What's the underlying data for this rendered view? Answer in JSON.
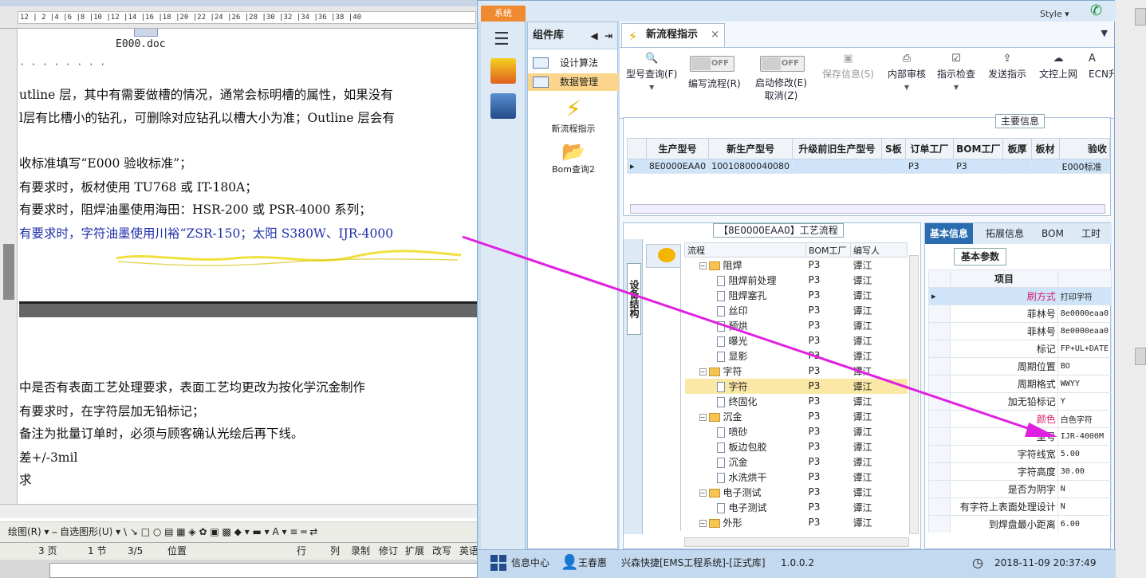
{
  "word": {
    "ruler_text": "12  | 2 |4 |6  |8  |10 |12 |14 |16 |18 |20 |22 |24 |26 |28 |30 |32 |34 |36 |38 |40",
    "file_caption": "E000.doc",
    "lines_top": [
      "· · · · · · · ·",
      "utline 层，其中有需要做槽的情况，通常会标明槽的属性，如果没有",
      "l层有比槽小的钻孔，可删除对应钻孔以槽大小为准；Outline 层会有",
      "",
      "收标准填写“E000 验收标准”；",
      "有要求时，板材使用 TU768 或 IT-180A；",
      "有要求时，阻焊油墨使用海田：HSR-200 或 PSR-4000 系列；",
      "有要求时，字符油墨使用川裕“ZSR-150；太阳 S380W、IJR-4000"
    ],
    "lines_bottom": [
      "中是否有表面工艺处理要求，表面工艺均更改为按化学沉金制作",
      "有要求时，在字符层加无铅标记；",
      "备注为批量订单时，必须与顾客确认光绘后再下线。",
      "差+/-3mil",
      "求"
    ],
    "draw_toolbar": "绘图(R) ▾  ⎯  自选图形(U) ▾  \\  ↘  □  ○  ▤  ▦  ◈  ✿  ▣  ▩   ◆ ▾  ▬ ▾  A ▾  ≡  ═  ⇄",
    "status": {
      "page": "3 页",
      "section": "1 节",
      "pos": "3/5",
      "at": "位置",
      "row": "行",
      "col": "列",
      "rec": "录制",
      "rev": "修订",
      "ext": "扩展",
      "ovr": "改写",
      "lang": "英语"
    }
  },
  "app": {
    "system_tab": "系统",
    "style_label": "Style ▾",
    "component_lib": "组件库",
    "components": [
      "设计算法",
      "数据管理"
    ],
    "launchers": [
      "新流程指示",
      "Bom查询2"
    ],
    "doc_tab": "新流程指示",
    "ribbon": {
      "b1": "型号查询(F)",
      "b2": "编写流程(R)",
      "b3": "启动修改(E)",
      "b3b": "取消(Z)",
      "b4": "保存信息(S)",
      "b5": "内部审核",
      "b6": "指示检查",
      "b7": "发送指示",
      "b8": "文控上网",
      "b9": "ECN升",
      "off": "OFF"
    },
    "main_info_label": "主要信息",
    "grid_headers": [
      "生产型号",
      "新生产型号",
      "升级前旧生产型号",
      "S板",
      "订单工厂",
      "BOM工厂",
      "板厚",
      "板材",
      "验收"
    ],
    "grid_row": [
      "8E0000EAA0",
      "10010800040080",
      "",
      "",
      "P3",
      "P3",
      "",
      "",
      "E000标准"
    ],
    "tree_title": "【8E0000EAA0】工艺流程",
    "side_tab": "设备结构",
    "tree_headers": [
      "流程",
      "BOM工厂",
      "编写人"
    ],
    "tree_rows": [
      {
        "name": "阻焊",
        "type": "folder",
        "factory": "P3",
        "author": "谭江"
      },
      {
        "name": "阻焊前处理",
        "type": "page",
        "factory": "P3",
        "author": "谭江"
      },
      {
        "name": "阻焊塞孔",
        "type": "page",
        "factory": "P3",
        "author": "谭江"
      },
      {
        "name": "丝印",
        "type": "page",
        "factory": "P3",
        "author": "谭江"
      },
      {
        "name": "预烘",
        "type": "page",
        "factory": "P3",
        "author": "谭江"
      },
      {
        "name": "曝光",
        "type": "page",
        "factory": "P3",
        "author": "谭江"
      },
      {
        "name": "显影",
        "type": "page",
        "factory": "P3",
        "author": "谭江"
      },
      {
        "name": "字符",
        "type": "folder",
        "factory": "P3",
        "author": "谭江"
      },
      {
        "name": "字符",
        "type": "page",
        "factory": "P3",
        "author": "谭江",
        "selected": true
      },
      {
        "name": "终固化",
        "type": "page",
        "factory": "P3",
        "author": "谭江"
      },
      {
        "name": "沉金",
        "type": "folder",
        "factory": "P3",
        "author": "谭江"
      },
      {
        "name": "喷砂",
        "type": "page",
        "factory": "P3",
        "author": "谭江"
      },
      {
        "name": "板边包胶",
        "type": "page",
        "factory": "P3",
        "author": "谭江"
      },
      {
        "name": "沉金",
        "type": "page",
        "factory": "P3",
        "author": "谭江"
      },
      {
        "name": "水洗烘干",
        "type": "page",
        "factory": "P3",
        "author": "谭江"
      },
      {
        "name": "电子测试",
        "type": "folder",
        "factory": "P3",
        "author": "谭江"
      },
      {
        "name": "电子测试",
        "type": "page",
        "factory": "P3",
        "author": "谭江"
      },
      {
        "name": "外形",
        "type": "folder",
        "factory": "P3",
        "author": "谭江"
      }
    ],
    "prop_tabs": [
      "基本信息",
      "拓展信息",
      "BOM",
      "工时"
    ],
    "prop_sub": "基本参数",
    "prop_header": "项目",
    "props": [
      {
        "k": "刷方式",
        "v": "打印字符",
        "sel": true,
        "red": true
      },
      {
        "k": "菲林号",
        "v": "8e0000eaa0"
      },
      {
        "k": "菲林号",
        "v": "8e0000eaa0"
      },
      {
        "k": "标记",
        "v": "FP+UL+DATE"
      },
      {
        "k": "周期位置",
        "v": "BO"
      },
      {
        "k": "周期格式",
        "v": "WWYY"
      },
      {
        "k": "加无铅标记",
        "v": "Y"
      },
      {
        "k": "颜色",
        "v": "白色字符",
        "red": true
      },
      {
        "k": "型号",
        "v": "IJR-4000M"
      },
      {
        "k": "字符线宽",
        "v": "5.00"
      },
      {
        "k": "字符高度",
        "v": "30.00"
      },
      {
        "k": "是否为阴字",
        "v": "N"
      },
      {
        "k": "有字符上表面处理设计",
        "v": "N"
      },
      {
        "k": "到焊盘最小距离",
        "v": "6.00"
      }
    ],
    "status": {
      "info_center": "信息中心",
      "user": "王春惠",
      "company": "兴森快捷[EMS工程系统]-[正式库]",
      "version": "1.0.0.2",
      "datetime": "2018-11-09 20:37:49"
    }
  },
  "colors": {
    "arrow": "#e020e0",
    "accent_orange": "#f08a30",
    "tab_blue": "#2b6cb0",
    "selection_yellow": "#fbd58b"
  }
}
